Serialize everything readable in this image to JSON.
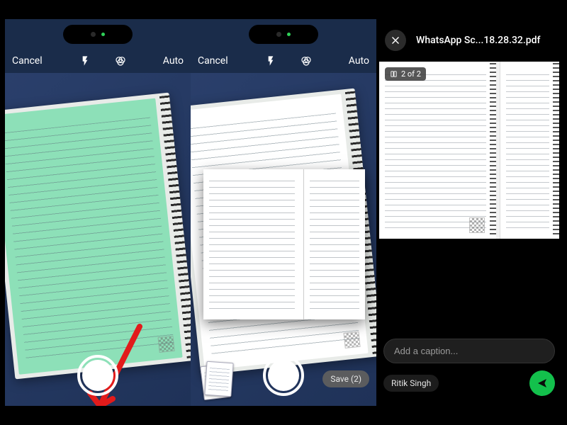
{
  "screen1": {
    "cancel": "Cancel",
    "auto": "Auto"
  },
  "screen2": {
    "cancel": "Cancel",
    "auto": "Auto",
    "save_label": "Save (2)"
  },
  "screen3": {
    "filename": "WhatsApp Sc...18.28.32.pdf",
    "page_badge": "2 of 2",
    "caption_placeholder": "Add a caption...",
    "recipient": "Ritik Singh"
  }
}
